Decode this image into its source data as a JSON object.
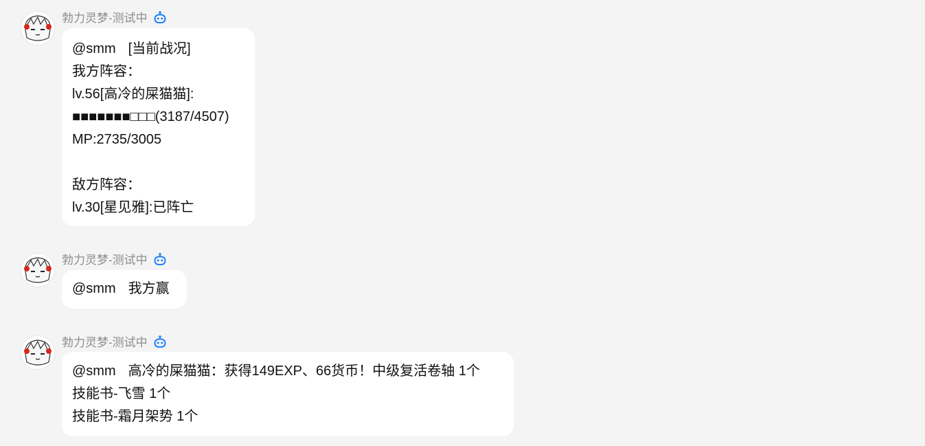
{
  "bot_name": "勃力灵梦-测试中",
  "colors": {
    "background": "#f4f4f4",
    "bubble": "#ffffff",
    "sender_text": "#8d8d8d",
    "bot_icon": "#1e80ff"
  },
  "icons": {
    "avatar": "anime-avatar",
    "bot_badge": "robot-icon"
  },
  "messages": [
    {
      "mention": "@smm",
      "lines": [
        "[当前战况]",
        "我方阵容：",
        "lv.56[高冷的屎猫猫]:",
        "■■■■■■■□□□(3187/4507)",
        "MP:2735/3005",
        "",
        "敌方阵容：",
        "lv.30[星见雅]:已阵亡"
      ]
    },
    {
      "mention": "@smm",
      "lines": [
        "我方赢"
      ]
    },
    {
      "mention": "@smm",
      "lines": [
        "高冷的屎猫猫：获得149EXP、66货币！中级复活卷轴 1个",
        "技能书-飞雪 1个",
        "技能书-霜月架势 1个"
      ]
    }
  ]
}
